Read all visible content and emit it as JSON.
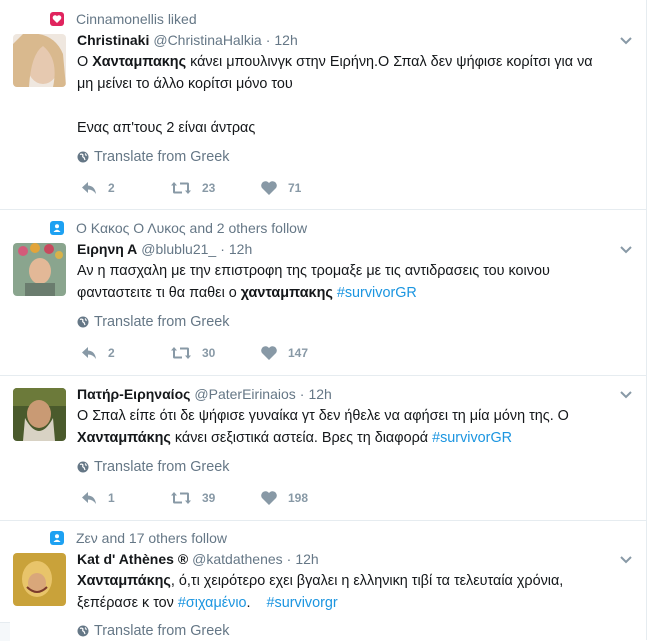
{
  "colors": {
    "accent": "#1da1f2",
    "like": "#e0245e",
    "muted": "#657786",
    "hashtag": "#1b95e0"
  },
  "tweets": [
    {
      "context": "Cinnamonellis liked",
      "context_icon": "heart-icon",
      "fullname": "Christinaki",
      "handle": "@ChristinaHalkia",
      "separator": "·",
      "time": "12h",
      "text": {
        "l1_pre": "Ο ",
        "l1_bold": "Χανταμπακης",
        "l1_post": " κάνει μπουλινγκ στην Ειρήνη.Ο Σπαλ δεν ψήφισε κορίτσι για να",
        "l2": "μη μείνει το άλλο κορίτσι μόνο του",
        "l4": "Ενας απ'τους 2 είναι άντρας"
      },
      "translate": "Translate from Greek",
      "reply_count": "2",
      "retweet_count": "23",
      "like_count": "71"
    },
    {
      "context": "Ο Κακος Ο Λυκος and 2 others follow",
      "context_icon": "user-icon",
      "fullname": "Ειρηνη Α",
      "handle": "@blublu21_",
      "separator": "·",
      "time": "12h",
      "text": {
        "l1": "Αν η πασχαλη με την επιστροφη της τρομαξε με τις αντιδρασεις του κοινου",
        "l2_pre": "φανταστειτε τι θα παθει ο ",
        "l2_bold": "χανταμπακης",
        "l2_space": " ",
        "l2_hashtag": "#survivorGR"
      },
      "translate": "Translate from Greek",
      "reply_count": "2",
      "retweet_count": "30",
      "like_count": "147"
    },
    {
      "context": "",
      "fullname": "Πατήρ-Ειρηναίος",
      "handle": "@PaterEirinaios",
      "separator": "·",
      "time": "12h",
      "text": {
        "l1": "Ο Σπαλ είπε ότι δε ψήφισε γυναίκα γτ δεν ήθελε να αφήσει τη μία μόνη της. Ο",
        "l2_bold": "Χανταμπάκης",
        "l2_post": " κάνει σεξιστικά αστεία. Βρες τη διαφορά ",
        "l2_hashtag": "#survivorGR"
      },
      "translate": "Translate from Greek",
      "reply_count": "1",
      "retweet_count": "39",
      "like_count": "198"
    },
    {
      "context": "Ζεν and 17 others follow",
      "context_icon": "user-icon",
      "fullname": "Kat d' Athènes ®",
      "handle": "@katdathenes",
      "separator": "·",
      "time": "12h",
      "text": {
        "l1_bold": "Χανταμπάκης",
        "l1_post": ", ό,τι χειρότερο εχει βγαλει η ελληνικη τιβί τα τελευταία χρόνια,",
        "l2_pre": "ξεπέρασε κ τον ",
        "l2_hashtag1": "#σιχαμένιο",
        "l2_mid": ".    ",
        "l2_hashtag2": "#survivorgr"
      },
      "translate": "Translate from Greek"
    }
  ]
}
